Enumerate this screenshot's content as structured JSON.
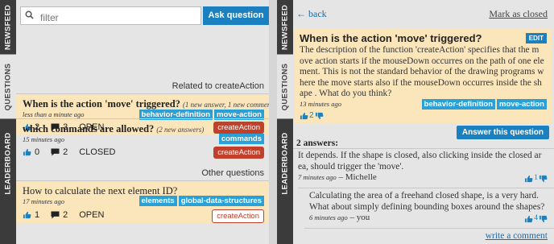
{
  "nav": {
    "tab_newsfeed": "NEWSFEED",
    "tab_questions": "QUESTIONS",
    "tab_leaderboard": "LEADERBOARD"
  },
  "search": {
    "placeholder": "filter"
  },
  "ask_button": "Ask question",
  "sections": {
    "related": "Related to createAction",
    "other": "Other questions"
  },
  "questions": [
    {
      "title": "When is the action 'move' triggered?",
      "meta": "(1 new answer, 1 new comment)",
      "time": "less than a minute ago",
      "tags": [
        "behavior-definition",
        "move-action"
      ],
      "votes": "2",
      "comments": "3",
      "status": "OPEN",
      "context": "createAction"
    },
    {
      "title": "which commands are allowed?",
      "meta": "(2 new answers)",
      "time": "15 minutes ago",
      "tags": [
        "commands"
      ],
      "votes": "0",
      "comments": "2",
      "status": "CLOSED",
      "context": "createAction"
    },
    {
      "title": "How to calculate the next element ID?",
      "meta": "",
      "time": "17 minutes ago",
      "tags": [
        "elements",
        "global-data-structures"
      ],
      "votes": "1",
      "comments": "2",
      "status": "OPEN",
      "context": "createAction"
    }
  ],
  "detail": {
    "back": "back",
    "mark_closed": "Mark as closed",
    "title": "When is the action 'move' triggered?",
    "edit": "EDIT",
    "body_lines": [
      "The description of the function 'createAction' specifies that the m",
      "ove action starts if the mouseDown occurres on the path of one ele",
      "ment. This is not the standard behavior of the drawing programs w",
      "here the move starts also if the mouseDown occurres inside the sh",
      "ape . What do you think?"
    ],
    "time": "13 minutes ago",
    "tags": [
      "behavior-definition",
      "move-action"
    ],
    "votes": "2",
    "answer_button": "Answer this question",
    "answers_count": "2 answers:",
    "answers": [
      {
        "lines": [
          "It depends. If the shape is closed, also clicking inside the closed ar",
          "ea, should trigger the 'move'."
        ],
        "time": "7 minutes ago",
        "author": "– Michelle",
        "votes": "1"
      },
      {
        "lines": [
          "Calculating the area of a freehand closed shape, is a very hard.",
          "What about simply defining bounding boxes around the shapes?"
        ],
        "time": "6 minutes ago",
        "author": "– you",
        "votes": "4"
      }
    ],
    "write_comment": "write a comment"
  },
  "colors": {
    "accent": "#1a80c0",
    "highlight": "#fbe6bc",
    "tag": "#2aa0d8",
    "context": "#c0402c",
    "rail": "#3b3b3b"
  },
  "icons": [
    "search-icon",
    "thumbs-up-icon",
    "comment-icon",
    "back-arrow-icon",
    "thumbs-down-icon"
  ]
}
